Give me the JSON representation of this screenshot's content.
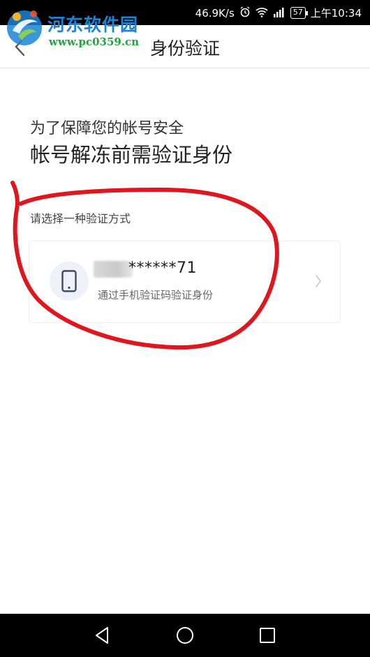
{
  "status_bar": {
    "net_speed": "46.9K/s",
    "battery": "57",
    "time": "上午10:34",
    "icons": [
      "alarm-icon",
      "wifi-icon",
      "signal-icon",
      "battery-icon"
    ]
  },
  "watermark": {
    "site_name": "河东软件园",
    "url": "www.pc0359.cn"
  },
  "header": {
    "title": "身份验证",
    "back_icon": "chevron-left-icon"
  },
  "intro": {
    "subtitle": "为了保障您的帐号安全",
    "title": "帐号解冻前需验证身份"
  },
  "verification": {
    "section_label": "请选择一种验证方式",
    "options": [
      {
        "icon": "mobile-phone-icon",
        "masked_phone": "******71",
        "description": "通过手机验证码验证身份"
      }
    ]
  },
  "nav_bar": {
    "buttons": [
      "back-triangle-icon",
      "home-circle-icon",
      "recents-square-icon"
    ]
  },
  "colors": {
    "annotation_red": "#e0161e",
    "watermark_blue": "#1a84d6",
    "watermark_green": "#1ea63a"
  }
}
